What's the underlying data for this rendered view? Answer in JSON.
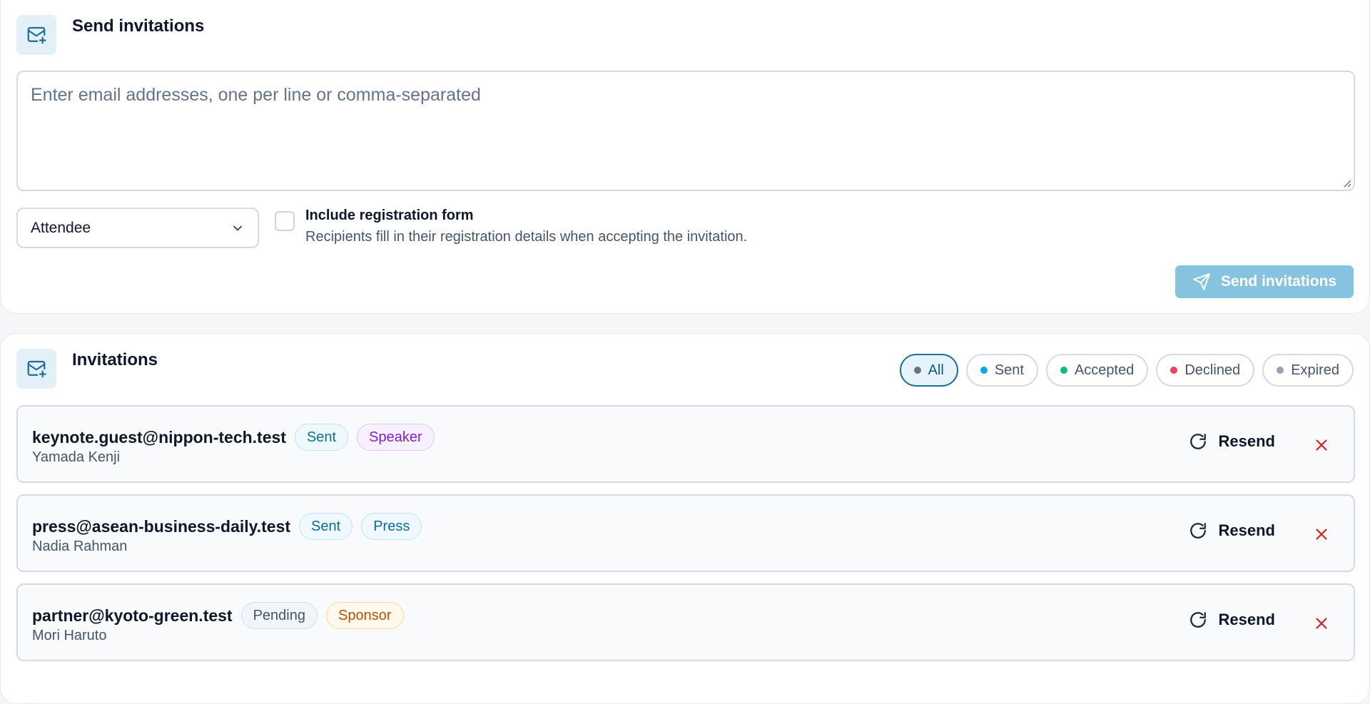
{
  "compose": {
    "title": "Send invitations",
    "icon": "mail-plus-icon",
    "emails_placeholder": "Enter email addresses, one per line or comma-separated",
    "role_selected": "Attendee",
    "include_form_label": "Include registration form",
    "include_form_desc": "Recipients fill in their registration details when accepting the invitation.",
    "include_form_checked": false,
    "send_label": "Send invitations",
    "send_disabled": true,
    "accent": "#86c3de"
  },
  "list": {
    "title": "Invitations",
    "icon": "mail-plus-icon",
    "filters": [
      {
        "label": "All",
        "dot": "#64748b",
        "active": true
      },
      {
        "label": "Sent",
        "dot": "#0ea5e9",
        "active": false
      },
      {
        "label": "Accepted",
        "dot": "#10b981",
        "active": false
      },
      {
        "label": "Declined",
        "dot": "#f43f5e",
        "active": false
      },
      {
        "label": "Expired",
        "dot": "#94a3b8",
        "active": false
      }
    ],
    "resend_label": "Resend",
    "items": [
      {
        "email": "keynote.guest@nippon-tech.test",
        "name": "Yamada Kenji",
        "status": {
          "label": "Sent",
          "color": "#0c6e9c",
          "bg": "#eef8fd",
          "border": "#bfe3f5"
        },
        "role": {
          "label": "Speaker",
          "color": "#7e22ce",
          "bg": "#f7f0fe",
          "border": "#dfc6f7"
        }
      },
      {
        "email": "press@asean-business-daily.test",
        "name": "Nadia Rahman",
        "status": {
          "label": "Sent",
          "color": "#0c6e9c",
          "bg": "#eef8fd",
          "border": "#bfe3f5"
        },
        "role": {
          "label": "Press",
          "color": "#0c6e9c",
          "bg": "#eef8fd",
          "border": "#bfe3f5"
        }
      },
      {
        "email": "partner@kyoto-green.test",
        "name": "Mori Haruto",
        "status": {
          "label": "Pending",
          "color": "#475569",
          "bg": "#f1f5f9",
          "border": "#d5dbe3"
        },
        "role": {
          "label": "Sponsor",
          "color": "#b45309",
          "bg": "#fff8ec",
          "border": "#f7d7a2"
        }
      }
    ]
  }
}
